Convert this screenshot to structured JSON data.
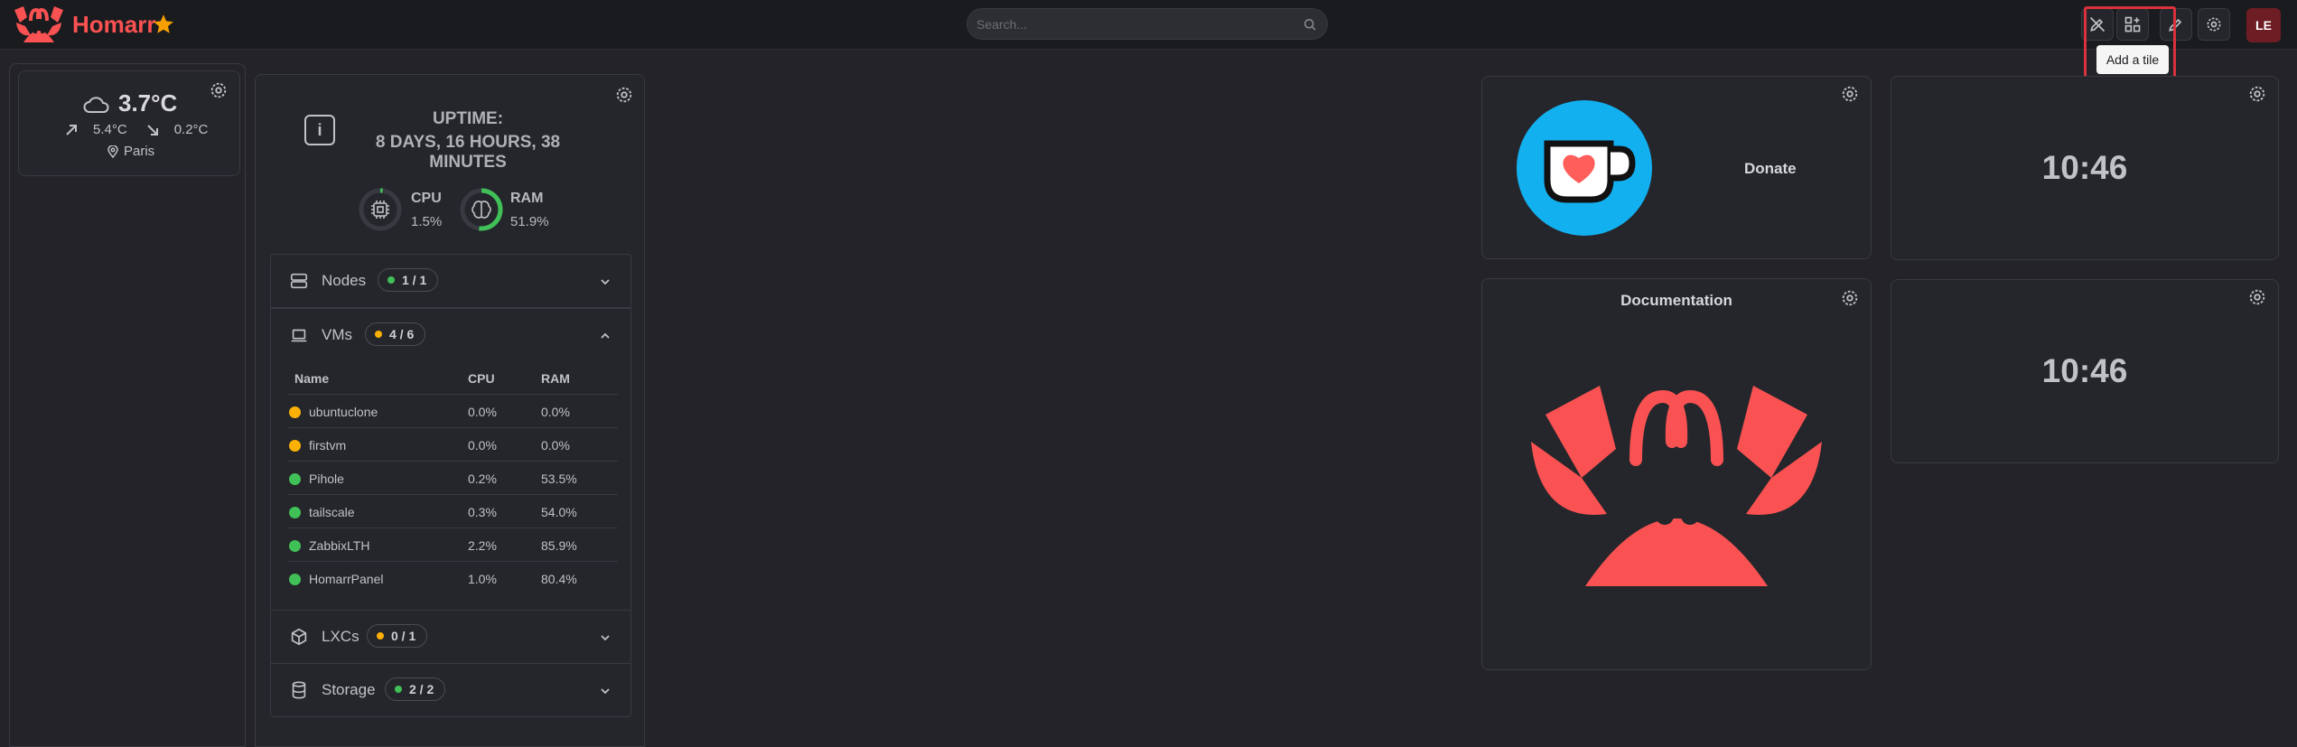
{
  "header": {
    "brand": "Homarr",
    "search_placeholder": "Search...",
    "tooltip": "Add a tile",
    "avatar": "LE",
    "icons": [
      "edit-off-icon",
      "add-tile-icon",
      "edit-icon",
      "settings-icon"
    ]
  },
  "colors": {
    "accent": "#fa5252",
    "green": "#40c057",
    "orange": "#fab005",
    "highlight": "#d9323c",
    "donate_bg": "#13b0f0"
  },
  "weather": {
    "temperature": "3.7°C",
    "high": "5.4°C",
    "low": "0.2°C",
    "city": "Paris"
  },
  "system": {
    "uptime_label": "UPTIME:",
    "uptime_value": "8 DAYS, 16 HOURS, 38 MINUTES",
    "cpu_label": "CPU",
    "cpu_value": "1.5%",
    "cpu_fraction": 0.015,
    "ram_label": "RAM",
    "ram_value": "51.9%",
    "ram_fraction": 0.519,
    "sections": {
      "nodes": {
        "title": "Nodes",
        "badge": "1 / 1"
      },
      "vms": {
        "title": "VMs",
        "badge": "4 / 6"
      },
      "lxcs": {
        "title": "LXCs",
        "badge": "0 / 1"
      },
      "storage": {
        "title": "Storage",
        "badge": "2 / 2"
      }
    },
    "vm_columns": [
      "Name",
      "CPU",
      "RAM"
    ],
    "vms": [
      {
        "name": "ubuntuclone",
        "cpu": "0.0%",
        "ram": "0.0%",
        "status": "stopped"
      },
      {
        "name": "firstvm",
        "cpu": "0.0%",
        "ram": "0.0%",
        "status": "stopped"
      },
      {
        "name": "Pihole",
        "cpu": "0.2%",
        "ram": "53.5%",
        "status": "running"
      },
      {
        "name": "tailscale",
        "cpu": "0.3%",
        "ram": "54.0%",
        "status": "running"
      },
      {
        "name": "ZabbixLTH",
        "cpu": "2.2%",
        "ram": "85.9%",
        "status": "running"
      },
      {
        "name": "HomarrPanel",
        "cpu": "1.0%",
        "ram": "80.4%",
        "status": "running"
      }
    ]
  },
  "tiles": {
    "donate_label": "Donate",
    "documentation_label": "Documentation",
    "clock_1": "10:46",
    "clock_2": "10:46"
  }
}
